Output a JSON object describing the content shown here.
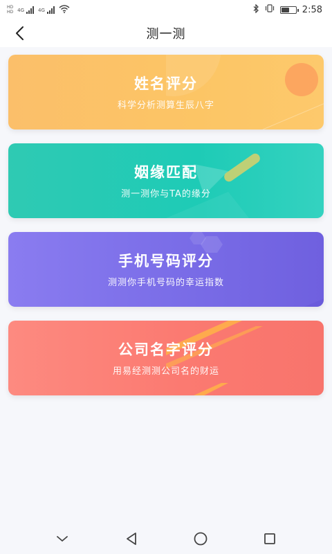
{
  "status_bar": {
    "sim1": "HD",
    "sim2": "HD",
    "net1": "4G",
    "net2": "4G",
    "time": "2:58"
  },
  "header": {
    "title": "测一测"
  },
  "cards": [
    {
      "title": "姓名评分",
      "subtitle": "科学分析测算生辰八字"
    },
    {
      "title": "姻缘匹配",
      "subtitle": "测一测你与TA的缘分"
    },
    {
      "title": "手机号码评分",
      "subtitle": "测测你手机号码的幸运指数"
    },
    {
      "title": "公司名字评分",
      "subtitle": "用易经测测公司名的财运"
    }
  ],
  "colors": {
    "name_card": "#fcc565",
    "marriage_card": "#1ecbb6",
    "phone_card": "#7b6ee8",
    "company_card": "#fb7a71"
  },
  "navbar": {
    "icons": [
      "chevron-down-icon",
      "back-triangle-icon",
      "home-circle-icon",
      "recents-square-icon"
    ]
  }
}
